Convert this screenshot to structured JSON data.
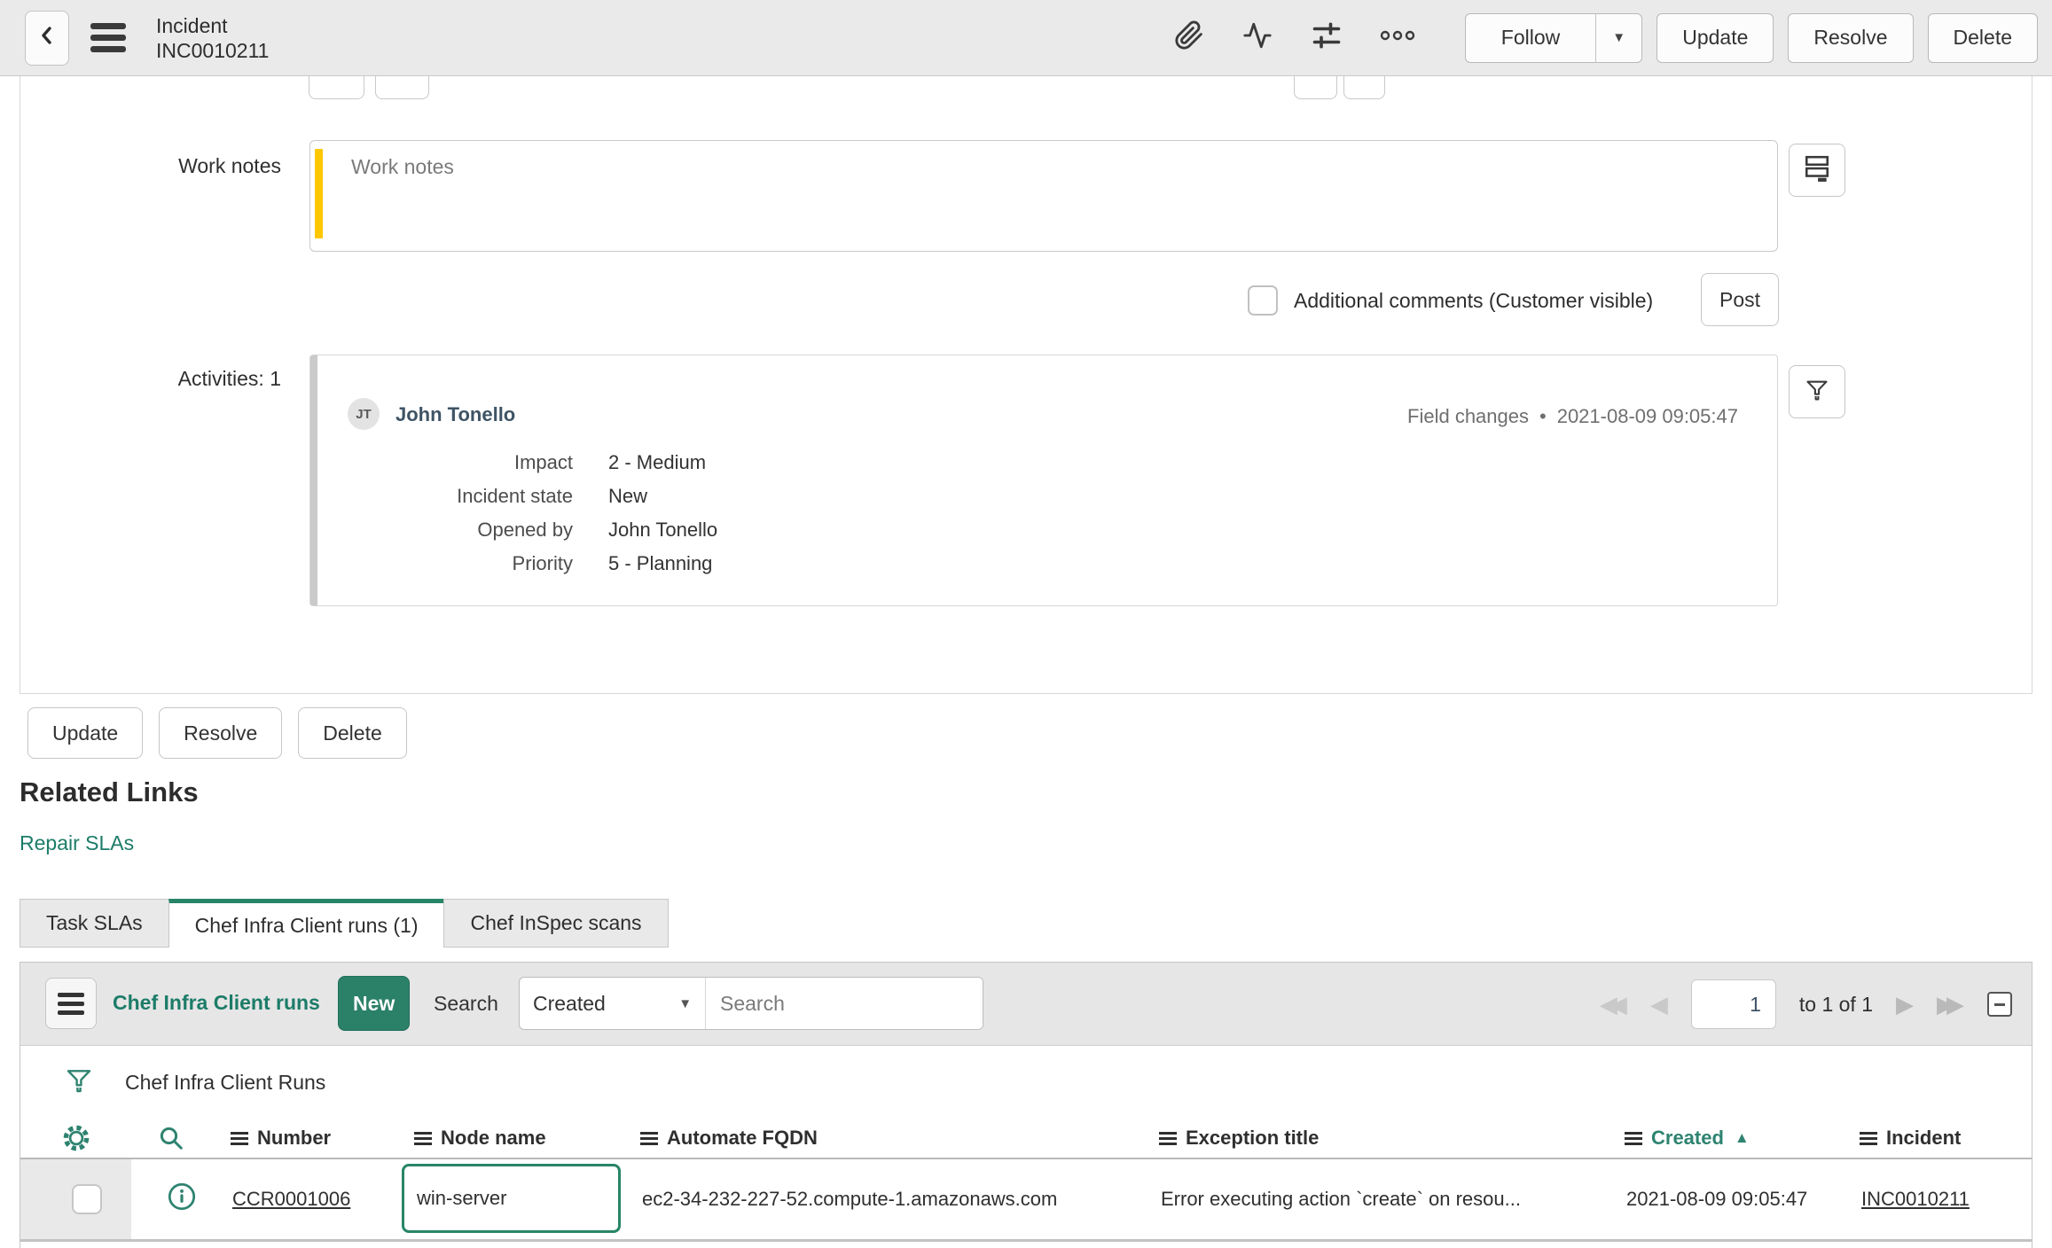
{
  "header": {
    "title_line1": "Incident",
    "title_line2": "INC0010211",
    "follow_label": "Follow",
    "update_label": "Update",
    "resolve_label": "Resolve",
    "delete_label": "Delete"
  },
  "icons": {
    "dropdown_arrow": "▼",
    "sort_ascending": "▲",
    "bullet": "•",
    "first_page": "◀◀",
    "prev_page": "◀",
    "next_page": "▶",
    "last_page": "▶▶"
  },
  "form": {
    "work_notes": {
      "label": "Work notes",
      "placeholder": "Work notes"
    },
    "comments": {
      "checkbox_label": "Additional comments (Customer visible)",
      "post_label": "Post"
    },
    "activities": {
      "label": "Activities: 1",
      "avatar_initials": "JT",
      "author": "John Tonello",
      "event_type": "Field changes",
      "timestamp": "2021-08-09 09:05:47",
      "fields": [
        {
          "label": "Impact",
          "value": "2 - Medium"
        },
        {
          "label": "Incident state",
          "value": "New"
        },
        {
          "label": "Opened by",
          "value": "John Tonello"
        },
        {
          "label": "Priority",
          "value": "5 - Planning"
        }
      ]
    }
  },
  "footer_actions": {
    "update": "Update",
    "resolve": "Resolve",
    "delete": "Delete"
  },
  "related_links": {
    "title": "Related Links",
    "repair_slas": "Repair SLAs"
  },
  "tabs": [
    {
      "label": "Task SLAs"
    },
    {
      "label": "Chef Infra Client runs (1)"
    },
    {
      "label": "Chef InSpec scans"
    }
  ],
  "list": {
    "title": "Chef Infra Client runs",
    "new_label": "New",
    "search_label": "Search",
    "search_field": "Created",
    "search_placeholder": "Search",
    "pagination": {
      "page": "1",
      "range": "to 1 of 1"
    },
    "filter_title": "Chef Infra Client Runs",
    "columns": [
      "Number",
      "Node name",
      "Automate FQDN",
      "Exception title",
      "Created",
      "Incident"
    ],
    "sorted_by": "Created",
    "rows": [
      {
        "number": "CCR0001006",
        "node_name": "win-server",
        "automate_fqdn": "ec2-34-232-227-52.compute-1.amazonaws.com",
        "exception_title": "Error executing action `create` on resou...",
        "created": "2021-08-09 09:05:47",
        "incident": "INC0010211"
      }
    ]
  },
  "colors": {
    "accent_teal": "#278568",
    "link_teal": "#1c7c68",
    "work_notes_yellow": "#ffc700"
  }
}
